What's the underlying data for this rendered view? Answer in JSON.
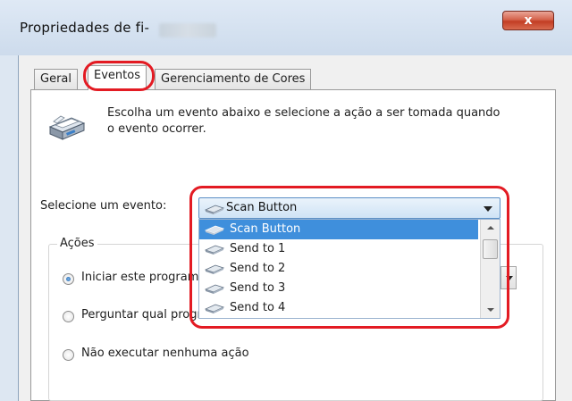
{
  "window": {
    "title": "Propriedades de fi-",
    "close_label": "x"
  },
  "tabs": [
    {
      "label": "Geral",
      "active": false
    },
    {
      "label": "Eventos",
      "active": true
    },
    {
      "label": "Gerenciamento de Cores",
      "active": false
    }
  ],
  "events_tab": {
    "description": "Escolha um evento abaixo e selecione a ação a ser tomada quando o evento ocorrer.",
    "select_label": "Selecione um evento:",
    "selected_event": "Scan Button",
    "event_options": [
      "Scan Button",
      "Send to 1",
      "Send to 2",
      "Send to 3",
      "Send to 4"
    ],
    "highlighted_option": "Scan Button"
  },
  "actions": {
    "group_label": "Ações",
    "options": [
      {
        "label": "Iniciar este programa",
        "checked": true
      },
      {
        "label": "Perguntar qual programa",
        "checked": false
      },
      {
        "label": "Não executar nenhuma ação",
        "checked": false
      }
    ]
  },
  "colors": {
    "highlight_ring": "#e31b23",
    "selection": "#3f8fdc",
    "close_button": "#c33d24"
  },
  "icons": [
    "scanner-icon",
    "scanner-small-icon",
    "chevron-down-icon",
    "close-icon"
  ]
}
